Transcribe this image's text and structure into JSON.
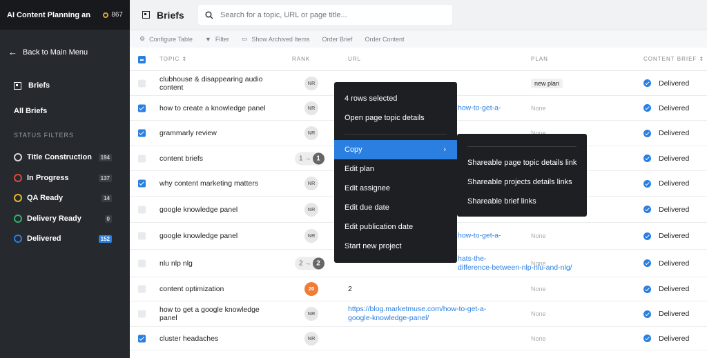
{
  "app": {
    "title": "AI Content Planning an...",
    "credits": "867"
  },
  "sidebar": {
    "back": "Back to Main Menu",
    "briefs": "Briefs",
    "all_briefs": "All Briefs",
    "status_filters": "STATUS FILTERS",
    "filters": [
      {
        "label": "Title Construction",
        "count": "194",
        "color": "#d9d9d9"
      },
      {
        "label": "In Progress",
        "count": "137",
        "color": "#e0483e"
      },
      {
        "label": "QA Ready",
        "count": "14",
        "color": "#e8b828"
      },
      {
        "label": "Delivery Ready",
        "count": "0",
        "color": "#2eb36a"
      },
      {
        "label": "Delivered",
        "count": "152",
        "color": "#2a7fe0"
      }
    ]
  },
  "header": {
    "title": "Briefs",
    "search_placeholder": "Search for a topic, URL or page title..."
  },
  "toolbar": {
    "configure": "Configure Table",
    "filter": "Filter",
    "archived": "Show Archived Items",
    "order_brief": "Order Brief",
    "order_content": "Order Content"
  },
  "columns": {
    "topic": "TOPIC",
    "rank": "RANK",
    "url": "URL",
    "plan": "PLAN",
    "content_brief": "CONTENT BRIEF"
  },
  "rows": [
    {
      "topic": "clubhouse & disappearing audio content",
      "rank": "NR",
      "url": "",
      "plan": "new plan",
      "status": "Delivered",
      "checked": false
    },
    {
      "topic": "how to create a knowledge panel",
      "rank": "NR",
      "url": "how-to-get-a-",
      "plan": "None",
      "status": "Delivered",
      "checked": true
    },
    {
      "topic": "grammarly review",
      "rank": "NR",
      "url": "",
      "plan": "None",
      "status": "Delivered",
      "checked": true
    },
    {
      "topic": "content briefs",
      "rank": "1",
      "rank_to": "1",
      "url": "",
      "plan": "",
      "status": "Delivered",
      "checked": false
    },
    {
      "topic": "why content marketing matters",
      "rank": "NR",
      "url": "",
      "plan": "",
      "status": "Delivered",
      "checked": true
    },
    {
      "topic": "google knowledge panel",
      "rank": "NR",
      "url": "",
      "plan": "",
      "status": "Delivered",
      "checked": false
    },
    {
      "topic": "google knowledge panel",
      "rank": "NR",
      "url": "how-to-get-a-",
      "plan": "None",
      "status": "Delivered",
      "checked": false
    },
    {
      "topic": "nlu nlp nlg",
      "rank": "2",
      "rank_to": "2",
      "url": "hats-the-",
      "url2": "difference-between-nlp-nlu-and-nlg/",
      "plan": "None",
      "status": "Delivered",
      "checked": false
    },
    {
      "topic": "content optimization",
      "rank": "20",
      "url": "2",
      "plan": "None",
      "status": "Delivered",
      "checked": false
    },
    {
      "topic": "how to get a google knowledge panel",
      "rank": "NR",
      "url": "https://blog.marketmuse.com/how-to-get-a-",
      "url2": "google-knowledge-panel/",
      "plan": "None",
      "status": "Delivered",
      "checked": false
    },
    {
      "topic": "cluster headaches",
      "rank": "NR",
      "url": "",
      "plan": "None",
      "status": "Delivered",
      "checked": true
    }
  ],
  "context_menu": {
    "header": "4 rows selected",
    "items": [
      "Open page topic details",
      "Copy",
      "Edit plan",
      "Edit assignee",
      "Edit due date",
      "Edit publication date",
      "Start new project"
    ]
  },
  "submenu": {
    "items": [
      "Shareable page topic details link",
      "Shareable projects details links",
      "Shareable brief links"
    ]
  }
}
